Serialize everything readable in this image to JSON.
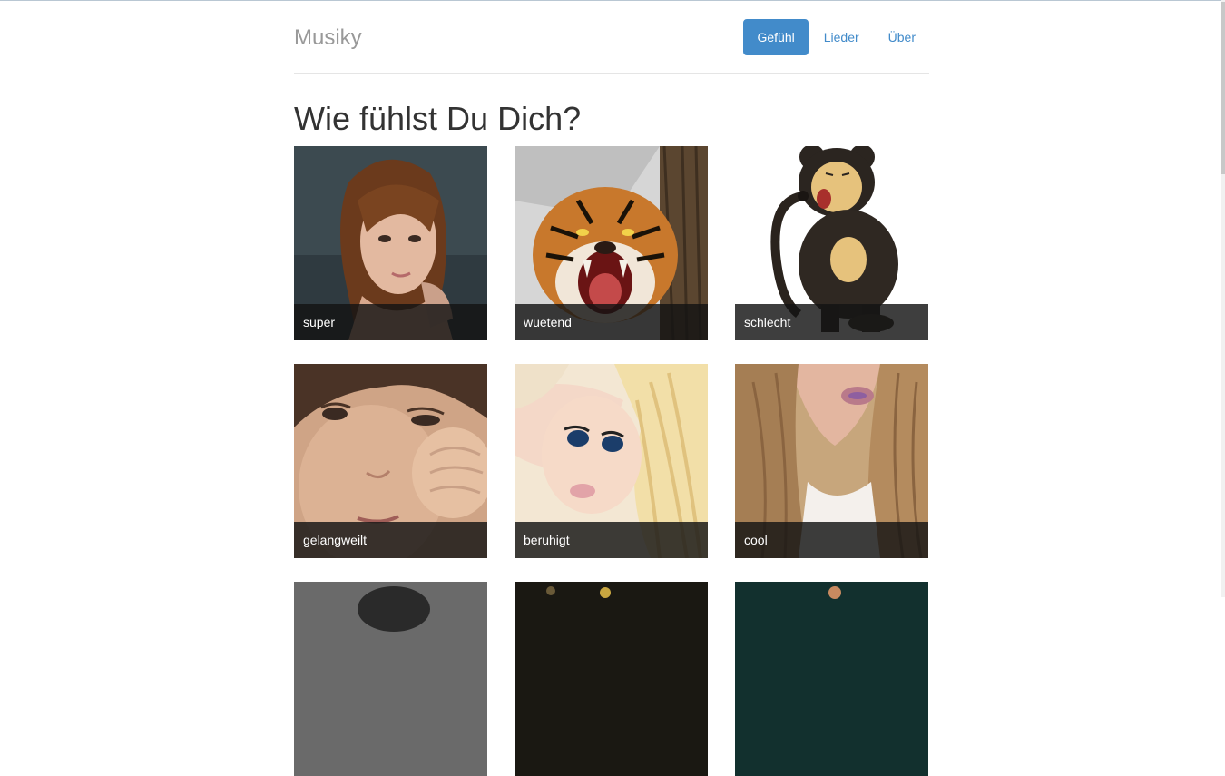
{
  "header": {
    "brand": "Musiky",
    "nav": [
      {
        "label": "Gefühl",
        "active": true
      },
      {
        "label": "Lieder",
        "active": false
      },
      {
        "label": "Über",
        "active": false
      }
    ]
  },
  "main": {
    "heading": "Wie fühlst Du Dich?",
    "moods": [
      {
        "label": "super"
      },
      {
        "label": "wuetend"
      },
      {
        "label": "schlecht"
      },
      {
        "label": "gelangweilt"
      },
      {
        "label": "beruhigt"
      },
      {
        "label": "cool"
      }
    ]
  },
  "colors": {
    "accent": "#428bca",
    "brand_text": "#999999",
    "caption_bg": "#141414"
  }
}
